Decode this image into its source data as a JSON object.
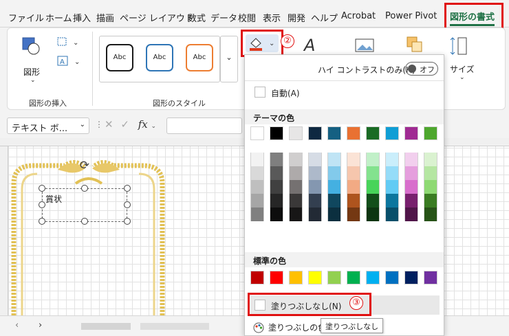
{
  "tabs": [
    "ファイル",
    "ホーム",
    "挿入",
    "描画",
    "ページ レイアウト",
    "数式",
    "データ",
    "校閲",
    "表示",
    "開発",
    "ヘルプ",
    "Acrobat",
    "Power Pivot",
    "図形の書式"
  ],
  "annotations": {
    "step1": "①",
    "step2": "②",
    "step3": "③"
  },
  "ribbon": {
    "shape_label": "図形",
    "insert_group": "図形の挿入",
    "style_group": "図形のスタイル",
    "size_label": "サイズ",
    "style_samples": [
      "Abc",
      "Abc",
      "Abc"
    ],
    "style_colors": [
      "#1a1a1a",
      "#2e75b6",
      "#ed7d31"
    ]
  },
  "formula_bar": {
    "name_box": "テキスト ボ...",
    "fx": "fx"
  },
  "shape": {
    "text": "賞状"
  },
  "fill_menu": {
    "high_contrast": "ハイ コントラストのみ(H)",
    "toggle": "オフ",
    "auto": "自動(A)",
    "theme_header": "テーマの色",
    "standard_header": "標準の色",
    "no_fill": "塗りつぶしなし(N)",
    "more_fill": "塗りつぶしの色",
    "tooltip": "塗りつぶしなし",
    "theme_top": [
      "#ffffff",
      "#000000",
      "#e7e6e6",
      "#0e2841",
      "#156082",
      "#e97132",
      "#196b24",
      "#0f9ed5",
      "#a02b93",
      "#4ea72e"
    ],
    "theme_cols": [
      [
        "#f2f2f2",
        "#d9d9d9",
        "#bfbfbf",
        "#a6a6a6",
        "#808080"
      ],
      [
        "#7f7f7f",
        "#595959",
        "#404040",
        "#262626",
        "#0d0d0d"
      ],
      [
        "#d0cece",
        "#aeaaaa",
        "#757171",
        "#3a3838",
        "#171616"
      ],
      [
        "#d6dce5",
        "#adb9ca",
        "#8497b0",
        "#333f50",
        "#222a35"
      ],
      [
        "#c0e4f5",
        "#82caeb",
        "#44b0e1",
        "#10475e",
        "#0b2f3f"
      ],
      [
        "#fbe3d6",
        "#f6c6ad",
        "#f2aa84",
        "#ae541e",
        "#743813"
      ],
      [
        "#c1f0c8",
        "#83e28e",
        "#47d45a",
        "#124f1a",
        "#0c3511"
      ],
      [
        "#caeefb",
        "#95dcf8",
        "#61cbf4",
        "#0c769e",
        "#084f6a"
      ],
      [
        "#f2cfee",
        "#e59edd",
        "#d86ecc",
        "#78206e",
        "#501549"
      ],
      [
        "#daf2d0",
        "#b5e6a2",
        "#8ed973",
        "#3a7c22",
        "#275317"
      ]
    ],
    "standard": [
      "#c00000",
      "#ff0000",
      "#ffc000",
      "#ffff00",
      "#92d050",
      "#00b050",
      "#00b0f0",
      "#0070c0",
      "#002060",
      "#7030a0"
    ]
  }
}
